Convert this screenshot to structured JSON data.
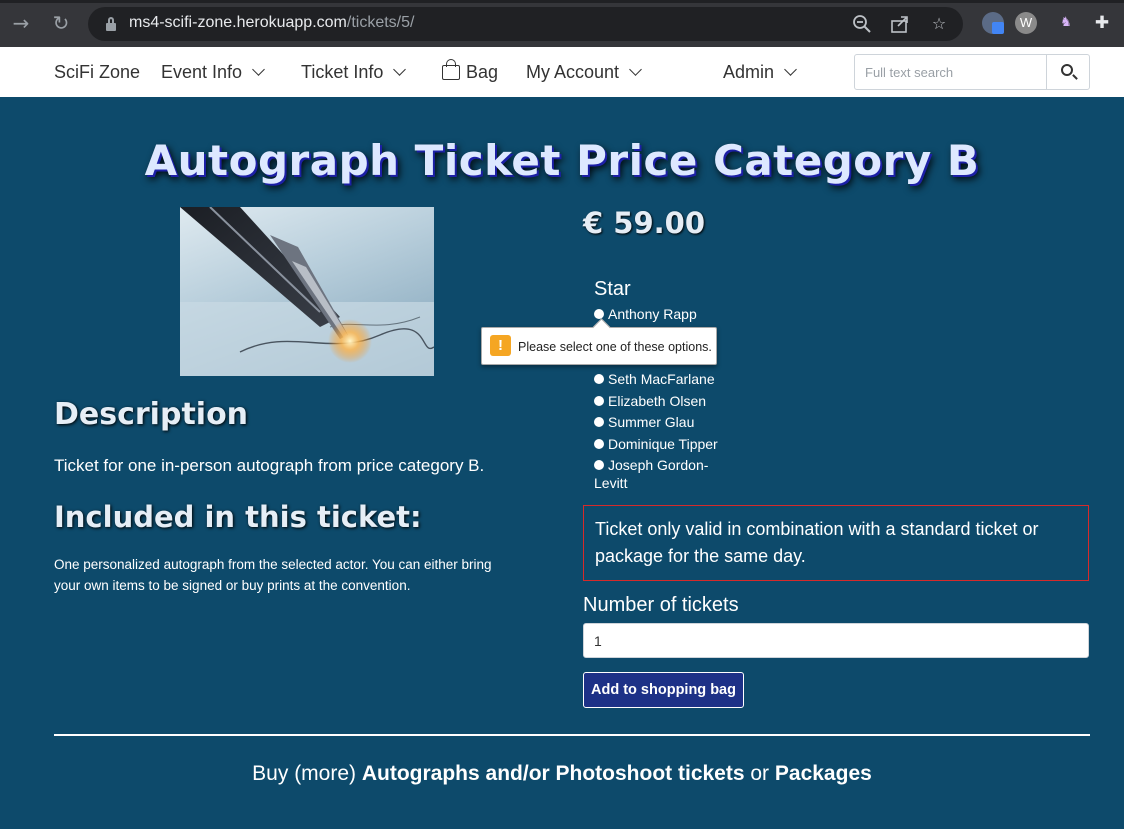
{
  "browser": {
    "url_host": "ms4-scifi-zone.herokuapp.com",
    "url_path": "/tickets/5/"
  },
  "navbar": {
    "brand": "SciFi Zone",
    "items": [
      {
        "label": "Event Info"
      },
      {
        "label": "Ticket Info"
      },
      {
        "label": "Bag"
      },
      {
        "label": "My Account"
      },
      {
        "label": "Admin"
      }
    ],
    "search_placeholder": "Full text search"
  },
  "product": {
    "title": "Autograph Ticket Price Category B",
    "price": "€ 59.00",
    "description_heading": "Description",
    "description": "Ticket for one in-person autograph from price category B.",
    "included_heading": "Included in this ticket:",
    "included_text_line1": "One personalized autograph from the selected actor. You can either bring",
    "included_text_line2": "your own items to be signed or buy prints at the convention."
  },
  "form": {
    "star_label": "Star",
    "stars": [
      "Anthony Rapp",
      "Seth MacFarlane",
      "Elizabeth Olsen",
      "Summer Glau",
      "Dominique Tipper",
      "Joseph Gordon-",
      "Levitt"
    ],
    "validation_message": "Please select one of these options.",
    "notice_line1": "Ticket only valid in combination with a standard ticket or",
    "notice_line2": "package for the same day.",
    "quantity_label": "Number of tickets",
    "quantity_value": "1",
    "submit_label": "Add to shopping bag"
  },
  "footer": {
    "prefix": "Buy (more) ",
    "link1": "Autographs and/or Photoshoot tickets",
    "middle": " or ",
    "link2": "Packages"
  }
}
